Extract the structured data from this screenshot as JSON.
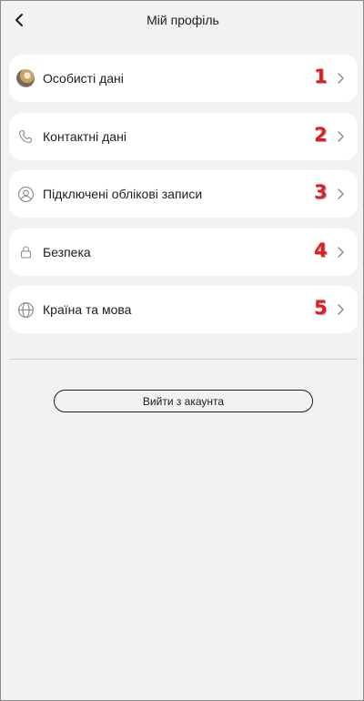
{
  "header": {
    "title": "Мій профіль",
    "back_icon": "chevron-left-icon"
  },
  "menu": [
    {
      "label": "Особисті дані",
      "icon": "avatar-photo-icon",
      "number": "1"
    },
    {
      "label": "Контактні дані",
      "icon": "phone-icon",
      "number": "2"
    },
    {
      "label": "Підключені облікові записи",
      "icon": "user-circle-icon",
      "number": "3"
    },
    {
      "label": "Безпека",
      "icon": "lock-icon",
      "number": "4"
    },
    {
      "label": "Країна та мова",
      "icon": "globe-icon",
      "number": "5"
    }
  ],
  "logout": {
    "label": "Вийти з акаунта"
  },
  "colors": {
    "background": "#f2f2f4",
    "card": "#ffffff",
    "annotation_number": "#e61b1b",
    "icon_gray": "#8e8e93"
  }
}
